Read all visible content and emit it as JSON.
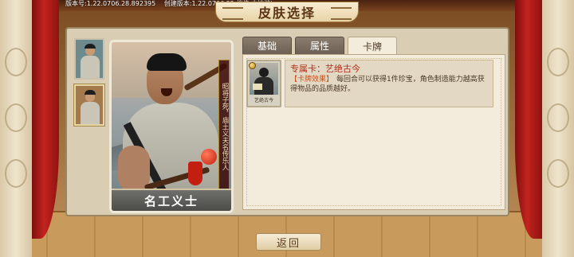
{
  "version_bar": {
    "version": "版本号:1.22.0706.28.892395",
    "build": "创建版本:1.22.0706.22,档位:本地档)"
  },
  "title": "皮肤选择",
  "skin_card": {
    "name": "名工义士",
    "vertical_text": "昭将子死，庙土义夫名传乐人"
  },
  "tabs": [
    {
      "label": "基础",
      "active": false
    },
    {
      "label": "属性",
      "active": false
    },
    {
      "label": "卡牌",
      "active": true
    }
  ],
  "exclusive_card": {
    "label": "艺绝古今",
    "title": "专属卡：艺绝古今",
    "effect_tag": "【卡牌效果】",
    "effect_text": "每回合可以获得1件珍宝，角色制造能力越高获得物品的品质越好。"
  },
  "return_button": "返回",
  "colors": {
    "curtain_red": "#c3231e",
    "accent_title": "#b0301c",
    "panel_bg": "#f3ecdd"
  }
}
